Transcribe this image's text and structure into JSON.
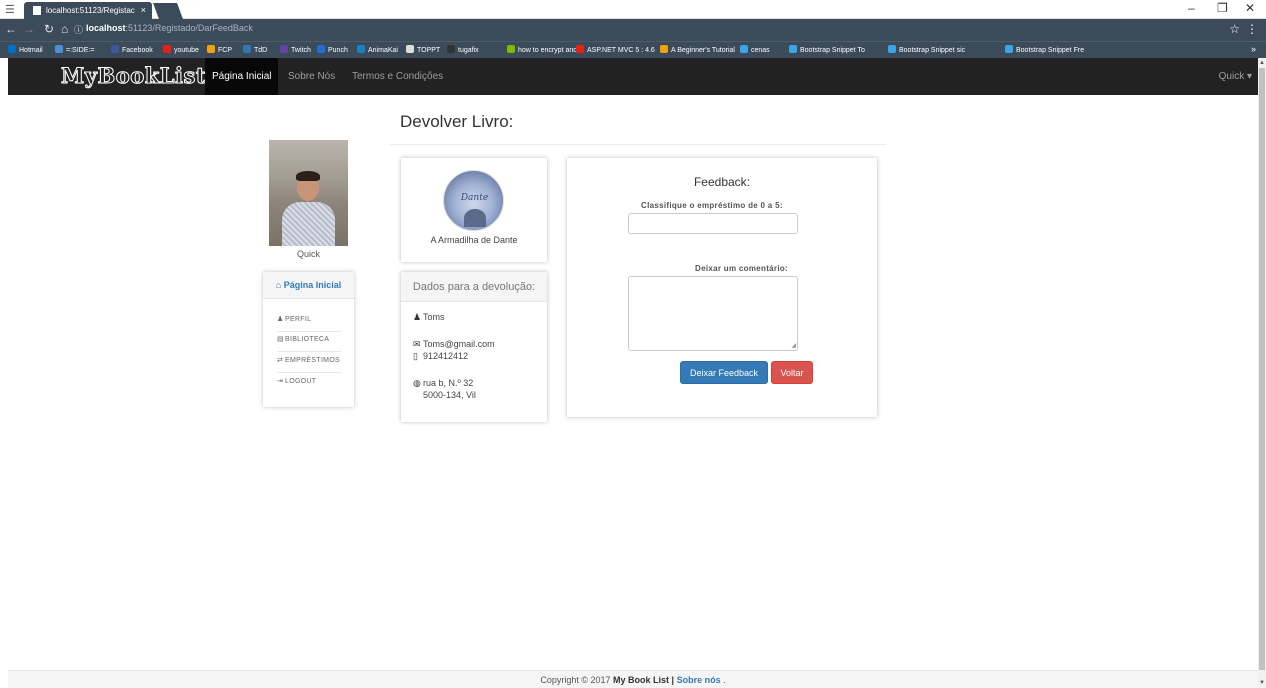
{
  "browser": {
    "tab_title": "localhost:51123/Registac",
    "tab_close": "×",
    "url_host": "localhost",
    "url_path": ":51123/Registado/DarFeedBack",
    "window_controls": [
      "–",
      "❐",
      "✕"
    ],
    "bookmarks": [
      {
        "label": "Hotmail",
        "color": "#0072c6"
      },
      {
        "label": "=:SIDE:=",
        "color": "#4a90d9"
      },
      {
        "label": "Facebook",
        "color": "#3b5998"
      },
      {
        "label": "youtube",
        "color": "#e62117"
      },
      {
        "label": "FCP",
        "color": "#f0a30a"
      },
      {
        "label": "TdD",
        "color": "#2a7ab0"
      },
      {
        "label": "Twitch",
        "color": "#6441a5"
      },
      {
        "label": "Punch",
        "color": "#1f6fd1"
      },
      {
        "label": "AnimaKai",
        "color": "#1c7fc4"
      },
      {
        "label": "TOPPT",
        "color": "#dddddd"
      },
      {
        "label": "tugafix",
        "color": "#333333"
      },
      {
        "label": "how to encrypt and d",
        "color": "#7cbb00"
      },
      {
        "label": "ASP.NET MVC 5 : 4.6",
        "color": "#e62117"
      },
      {
        "label": "A Beginner's Tutorial",
        "color": "#f0a30a"
      },
      {
        "label": "cenas",
        "color": "#3aa6e8"
      },
      {
        "label": "Bootstrap Snippet To",
        "color": "#3aa6e8"
      },
      {
        "label": "Bootstrap Snippet sic",
        "color": "#3aa6e8"
      },
      {
        "label": "Bootstrap Snippet Fre",
        "color": "#3aa6e8"
      }
    ],
    "more": "»"
  },
  "navbar": {
    "brand": "MyBookList",
    "items": [
      "Página Inicial",
      "Sobre Nós",
      "Termos e Condições"
    ],
    "user": "Quick ▾"
  },
  "page": {
    "title": "Devolver Livro:"
  },
  "profile": {
    "name": "Quick"
  },
  "side_menu": {
    "home": "Página Inicial",
    "items": [
      "PERFIL",
      "BIBLIOTECA",
      "EMPRÉSTIMOS",
      "LOGOUT"
    ]
  },
  "book": {
    "cover_text": "Dante",
    "title": "A Armadilha de Dante"
  },
  "return_info": {
    "header": "Dados para a devolução:",
    "name": "Toms",
    "email": "Toms@gmail.com",
    "phone": "912412412",
    "address_line1": "rua b, N.º 32",
    "address_line2": "5000-134, Vil"
  },
  "feedback": {
    "title": "Feedback:",
    "rating_label": "Classifique o empréstimo de 0 a 5:",
    "rating_value": "",
    "comment_label": "Deixar um comentário:",
    "comment_value": "",
    "submit": "Deixar Feedback",
    "back": "Voltar"
  },
  "footer": {
    "prefix": "Copyright © 2017",
    "brand": "My Book List |",
    "link": "Sobre nós",
    "suffix": "."
  },
  "colors": {
    "navbar": "#222222",
    "primary": "#337ab7",
    "danger": "#d9534f",
    "chrome": "#3c4b5a"
  }
}
